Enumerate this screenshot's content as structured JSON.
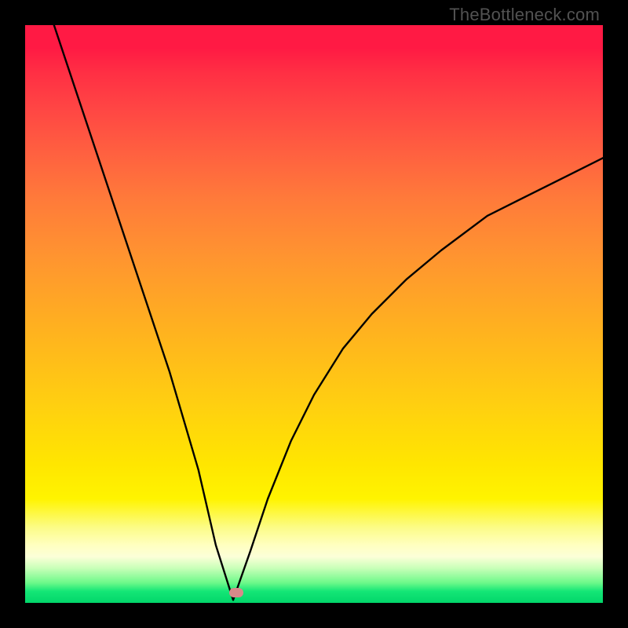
{
  "watermark": "TheBottleneck.com",
  "chart_data": {
    "type": "line",
    "title": "",
    "xlabel": "",
    "ylabel": "",
    "xlim": [
      0,
      100
    ],
    "ylim": [
      0,
      100
    ],
    "curve": {
      "name": "bottleneck-curve",
      "description": "V-shaped curve (absolute-value-like) with minimum near x≈36, y≈0; steep left arm starting near y≈100 at x≈5, right arm rising and flattening toward y≈77 at x≈100.",
      "x": [
        5,
        10,
        15,
        20,
        25,
        30,
        33,
        36,
        39,
        42,
        46,
        50,
        55,
        60,
        66,
        72,
        80,
        88,
        94,
        100
      ],
      "y": [
        100,
        85,
        70,
        55,
        40,
        23,
        10,
        0.5,
        9,
        18,
        28,
        36,
        44,
        50,
        56,
        61,
        67,
        71,
        74,
        77
      ]
    },
    "marker": {
      "x": 36.5,
      "y": 1.0
    },
    "gradient_stops": [
      {
        "pos": 0.0,
        "color": "#ff1a44"
      },
      {
        "pos": 0.5,
        "color": "#ffb020"
      },
      {
        "pos": 0.85,
        "color": "#ffe600"
      },
      {
        "pos": 1.0,
        "color": "#02d66a"
      }
    ]
  }
}
